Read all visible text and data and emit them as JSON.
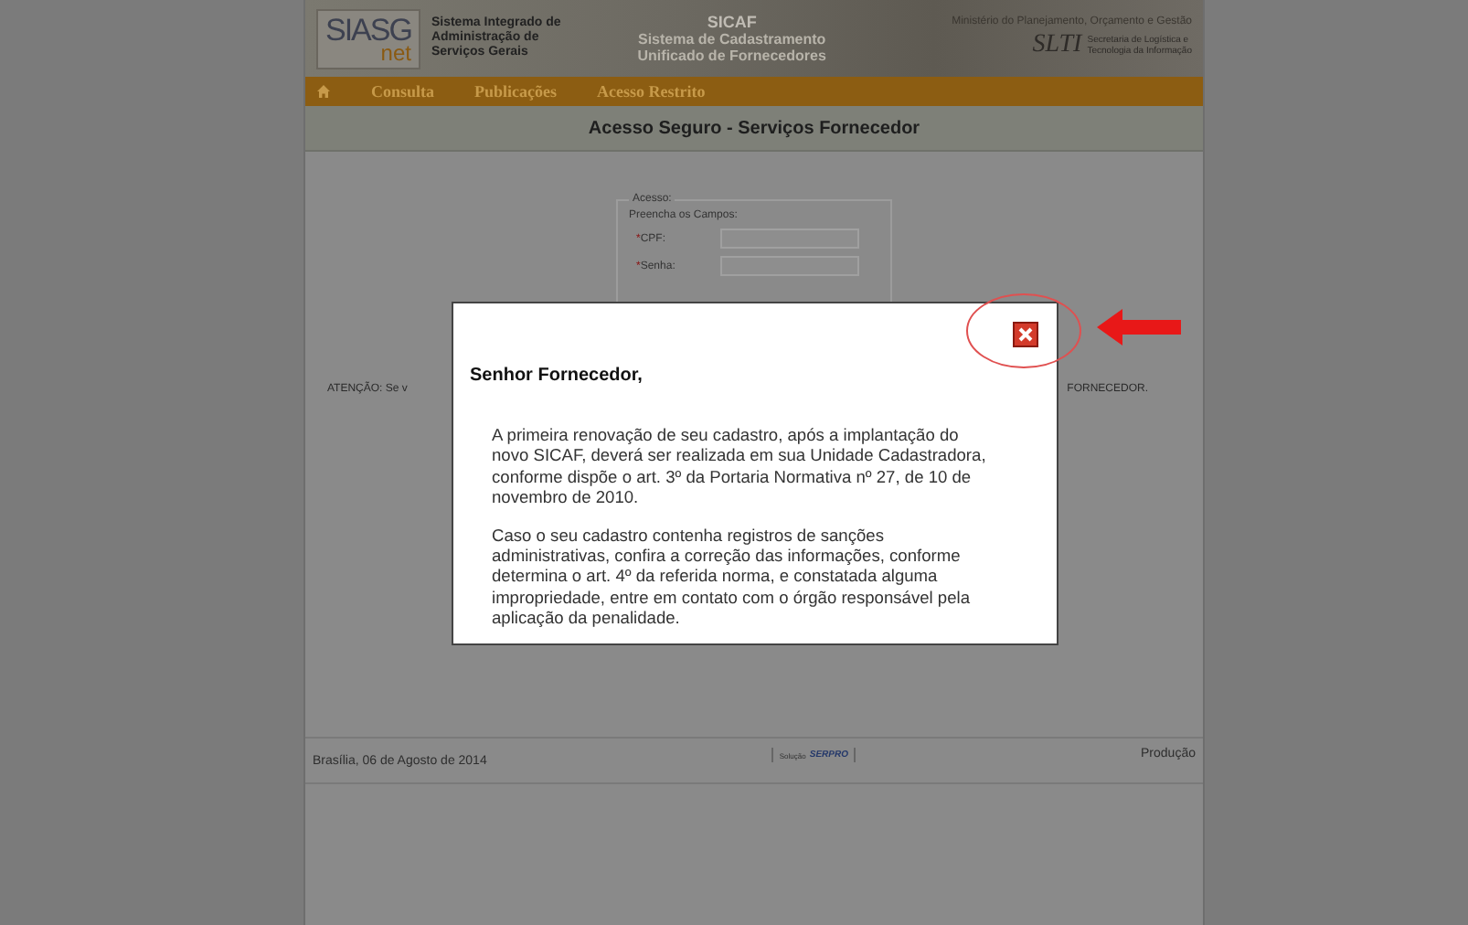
{
  "header": {
    "logo": {
      "main": "SIASG",
      "sub": "net"
    },
    "system_name": [
      "Sistema Integrado de",
      "Administração de",
      "Serviços Gerais"
    ],
    "banner": {
      "title": "SICAF",
      "subtitle": [
        "Sistema de Cadastramento",
        "Unificado de Fornecedores"
      ]
    },
    "ministry": "Ministério do Planejamento, Orçamento e Gestão",
    "agency": {
      "logo": "SLTI",
      "name": [
        "Secretaria de Logística e",
        "Tecnologia da Informação"
      ]
    }
  },
  "nav": {
    "items": [
      {
        "label": "Consulta"
      },
      {
        "label": "Publicações"
      },
      {
        "label": "Acesso Restrito"
      }
    ]
  },
  "page_title": "Acesso Seguro - Serviços Fornecedor",
  "login": {
    "legend": "Acesso:",
    "instruction": "Preencha os Campos:",
    "fields": [
      {
        "label": "CPF:",
        "required_mark": "*"
      },
      {
        "label": "Senha:",
        "required_mark": "*"
      }
    ]
  },
  "notice": {
    "left": "ATENÇÃO: Se v",
    "right": "FORNECEDOR."
  },
  "footer": {
    "date": "Brasília, 06 de Agosto de 2014",
    "badge": {
      "prefix": "Solução",
      "brand": "SERPRO"
    },
    "environment": "Produção"
  },
  "modal": {
    "heading": "Senhor Fornecedor,",
    "paragraphs": [
      "A primeira renovação de seu cadastro, após a implantação do novo SICAF, deverá ser realizada em sua Unidade Cadastradora, conforme dispõe o art. 3º da Portaria Normativa nº 27, de 10 de novembro de 2010.",
      "Caso o seu cadastro contenha registros de sanções administrativas, confira a correção das informações, conforme determina o art. 4º da referida norma, e constatada alguma impropriedade, entre em contato com o órgão responsável pela aplicação da penalidade."
    ]
  }
}
